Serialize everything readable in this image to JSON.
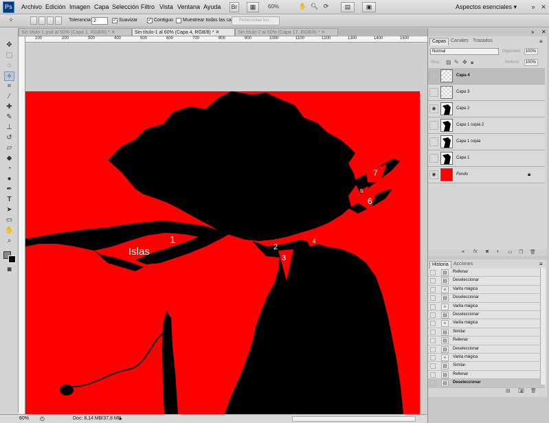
{
  "menubar": {
    "logo": "Ps",
    "items": [
      "Archivo",
      "Edición",
      "Imagen",
      "Capa",
      "Selección",
      "Filtro",
      "Vista",
      "Ventana",
      "Ayuda"
    ],
    "zoom": "60%",
    "workspace": "Aspectos esenciales"
  },
  "options": {
    "tolerance_label": "Tolerancia:",
    "tolerance_value": "2",
    "smooth_label": "Suavizar",
    "contiguous_label": "Contiguo",
    "sample_all_label": "Muestrear todas las capas",
    "refine_label": "Perfeccionar bor..."
  },
  "tabs": [
    {
      "label": "Sin título-1.psd al 50% (Capa 1, RGB/8) *",
      "active": false
    },
    {
      "label": "Sin título-1 al 60% (Capa 4, RGB/8) *",
      "active": true
    },
    {
      "label": "Sin título-2 al 50% (Capa 17, RGB/8) *",
      "active": false
    }
  ],
  "ruler_labels": [
    "100",
    "200",
    "300",
    "400",
    "500",
    "600",
    "700",
    "800",
    "900",
    "1000",
    "1100",
    "1200",
    "1300",
    "1400",
    "1500"
  ],
  "canvas": {
    "bg_color": "#ff0000",
    "labels": [
      "Islas",
      "1",
      "2",
      "3",
      "4",
      "5",
      "6",
      "7"
    ]
  },
  "status": {
    "zoom": "60%",
    "doc": "Doc: 8,14 MB/37,8 MB"
  },
  "layers": {
    "tabs": [
      "Capas",
      "Canales",
      "Trazados"
    ],
    "blend_mode": "Normal",
    "opacity_label": "Opacidad:",
    "opacity": "100%",
    "lock_label": "Bloq.:",
    "fill_label": "Relleno:",
    "fill": "100%",
    "items": [
      {
        "name": "Capa 4",
        "visible": false,
        "selected": true
      },
      {
        "name": "Capa 3",
        "visible": false,
        "selected": false
      },
      {
        "name": "Capa 2",
        "visible": true,
        "selected": false
      },
      {
        "name": "Capa 1 copia 2",
        "visible": false,
        "selected": false
      },
      {
        "name": "Capa 1 copia",
        "visible": false,
        "selected": false
      },
      {
        "name": "Capa 1",
        "visible": false,
        "selected": false
      },
      {
        "name": "Fondo",
        "visible": true,
        "selected": false
      }
    ]
  },
  "history": {
    "tabs": [
      "Historia",
      "Acciones"
    ],
    "items": [
      {
        "name": "Rellenar",
        "icon": "fill-icon"
      },
      {
        "name": "Deseleccionar",
        "icon": "deselect-icon"
      },
      {
        "name": "Varita mágica",
        "icon": "magic-wand-icon"
      },
      {
        "name": "Deseleccionar",
        "icon": "deselect-icon"
      },
      {
        "name": "Varita mágica",
        "icon": "magic-wand-icon"
      },
      {
        "name": "Deseleccionar",
        "icon": "deselect-icon"
      },
      {
        "name": "Varita mágica",
        "icon": "magic-wand-icon"
      },
      {
        "name": "Similar",
        "icon": "similar-icon"
      },
      {
        "name": "Rellenar",
        "icon": "fill-icon"
      },
      {
        "name": "Deseleccionar",
        "icon": "deselect-icon"
      },
      {
        "name": "Varita mágica",
        "icon": "magic-wand-icon"
      },
      {
        "name": "Similar",
        "icon": "similar-icon"
      },
      {
        "name": "Rellenar",
        "icon": "fill-icon"
      },
      {
        "name": "Deseleccionar",
        "icon": "deselect-icon"
      }
    ]
  }
}
